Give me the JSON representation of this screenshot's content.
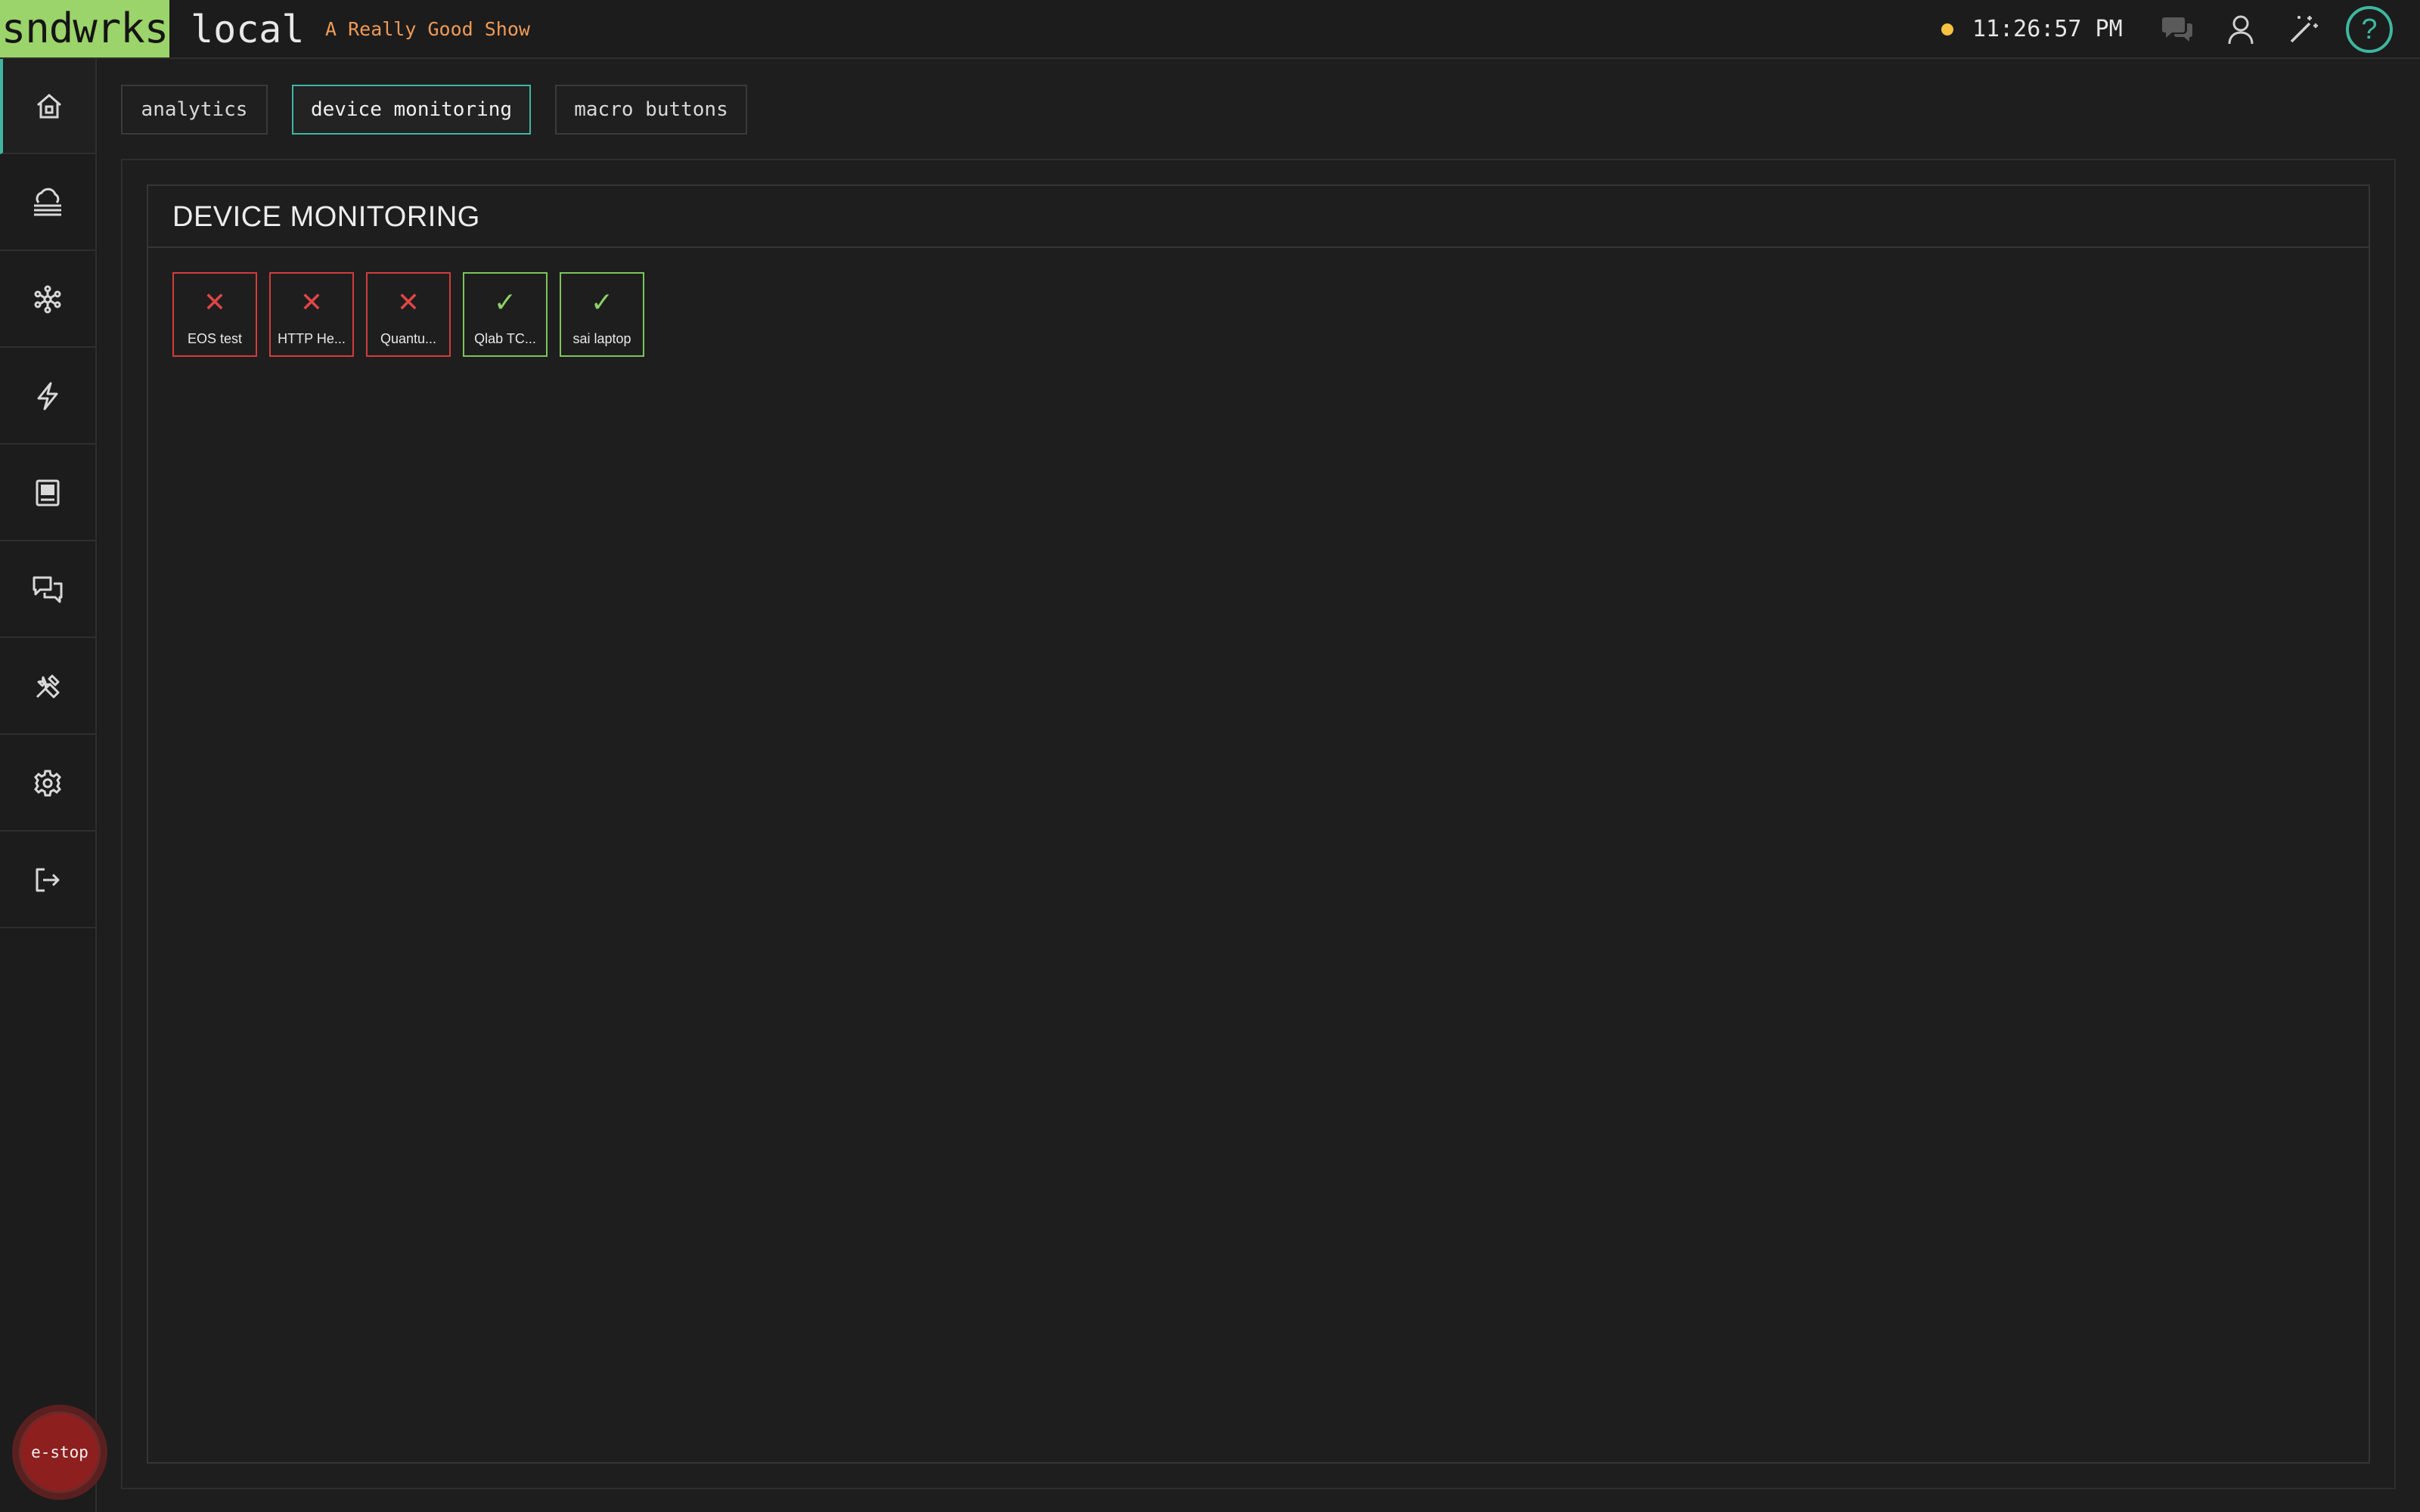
{
  "header": {
    "logo": "sndwrks",
    "host": "local",
    "show_name": "A Really Good Show",
    "clock": "11:26:57 PM",
    "status_color": "#f5c242",
    "icons": [
      "chat-icon",
      "user-icon",
      "magic-wand-icon"
    ],
    "help_label": "?"
  },
  "sidebar": {
    "items": [
      {
        "name": "home-icon",
        "active": true
      },
      {
        "name": "cloud-devices-icon"
      },
      {
        "name": "network-icon"
      },
      {
        "name": "lightning-icon"
      },
      {
        "name": "monitor-icon"
      },
      {
        "name": "messages-icon"
      },
      {
        "name": "tools-icon"
      },
      {
        "name": "settings-icon"
      },
      {
        "name": "logout-icon"
      }
    ],
    "estop_label": "e-stop"
  },
  "tabs": [
    {
      "label": "analytics",
      "active": false
    },
    {
      "label": "device monitoring",
      "active": true
    },
    {
      "label": "macro buttons",
      "active": false
    }
  ],
  "panel": {
    "title": "DEVICE MONITORING",
    "devices": [
      {
        "name": "EOS test",
        "status": "error",
        "mark": "✕"
      },
      {
        "name": "HTTP He...",
        "status": "error",
        "mark": "✕"
      },
      {
        "name": "Quantu...",
        "status": "error",
        "mark": "✕"
      },
      {
        "name": "Qlab TC...",
        "status": "ok",
        "mark": "✓"
      },
      {
        "name": "sai laptop",
        "status": "ok",
        "mark": "✓"
      }
    ]
  },
  "colors": {
    "accent": "#3fb6a0",
    "logo_bg": "#9bd46a",
    "show_name": "#f09a57",
    "error": "#d23c3c",
    "ok": "#7dc45b"
  }
}
